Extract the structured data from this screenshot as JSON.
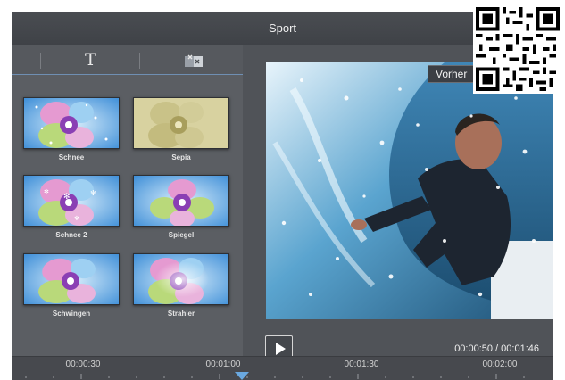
{
  "window": {
    "title": "Sport"
  },
  "toolbar": {
    "tabs": [
      {
        "icon": "text-icon",
        "glyph": "T"
      },
      {
        "icon": "transition-icon"
      }
    ]
  },
  "effects": [
    {
      "label": "Schnee"
    },
    {
      "label": "Sepia"
    },
    {
      "label": "Schnee 2"
    },
    {
      "label": "Spiegel"
    },
    {
      "label": "Schwingen"
    },
    {
      "label": "Strahler"
    }
  ],
  "preview": {
    "split_label": "Vorher"
  },
  "player": {
    "time": "00:00:50 / 00:01:46"
  },
  "timeline": {
    "ticks": [
      "00:00:30",
      "00:01:00",
      "00:01:30",
      "00:02:00"
    ]
  },
  "colors": {
    "accent": "#6aa8e0",
    "panel": "#5b5e63",
    "titlebar": "#45484d"
  }
}
